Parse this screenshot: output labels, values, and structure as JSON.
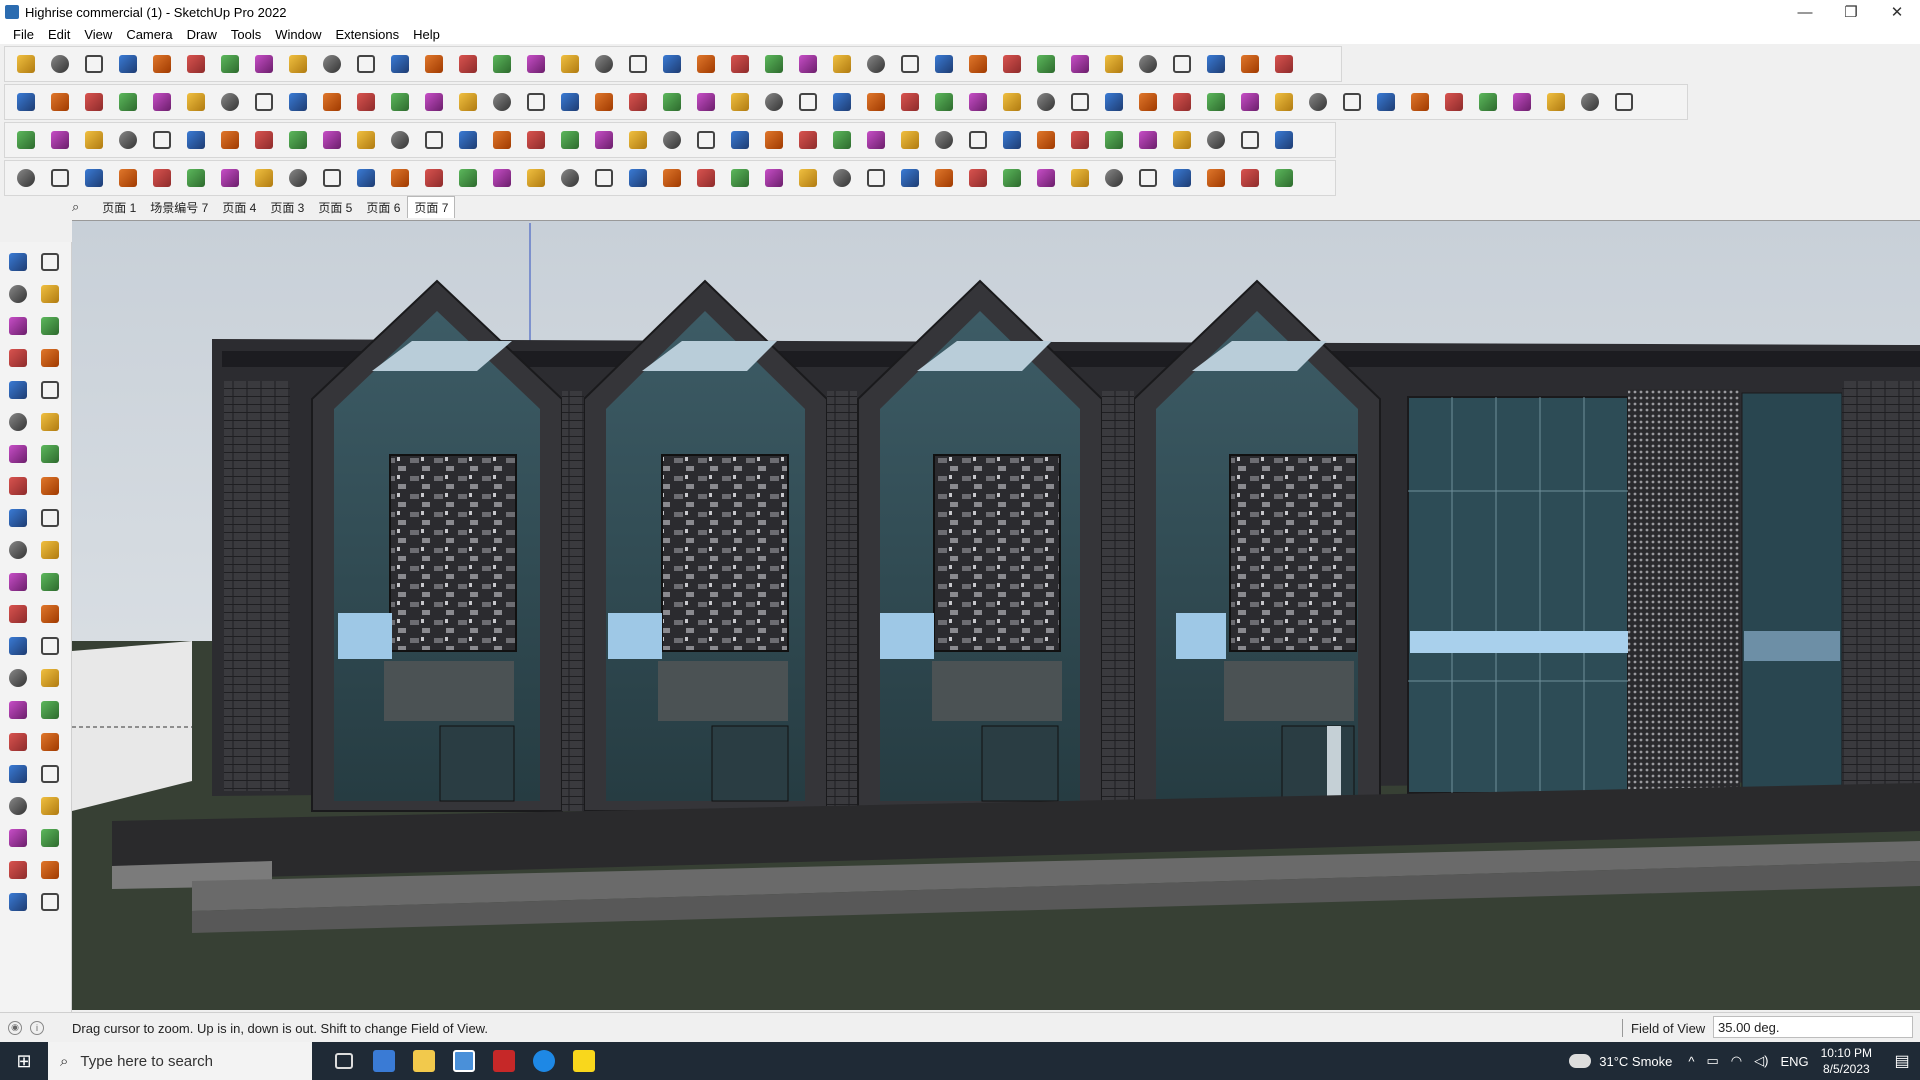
{
  "window": {
    "title": "Highrise commercial (1) - SketchUp Pro 2022",
    "controls": {
      "minimize": "—",
      "restore": "❐",
      "close": "✕"
    }
  },
  "menu": [
    "File",
    "Edit",
    "View",
    "Camera",
    "Draw",
    "Tools",
    "Window",
    "Extensions",
    "Help"
  ],
  "scenes": {
    "tabs": [
      "页面 1",
      "场景编号 7",
      "页面 4",
      "页面 3",
      "页面 5",
      "页面 6",
      "页面 7"
    ],
    "active_index": 6
  },
  "status": {
    "hint": "Drag cursor to zoom.  Up is in, down is out. Shift to change Field of View.",
    "measure_label": "Field of View",
    "measure_value": "35.00 deg."
  },
  "taskbar": {
    "search_placeholder": "Type here to search",
    "weather": "31°C  Smoke",
    "language": "ENG",
    "time": "10:10 PM",
    "date": "8/5/2023"
  },
  "colors": {
    "sky_top": "#c8d0d8",
    "sky_bottom": "#e6e9ec",
    "ground": "#374034",
    "building_dark": "#2f2f33",
    "glass": "#2e4a52",
    "glass_light": "#9ec8e6"
  }
}
